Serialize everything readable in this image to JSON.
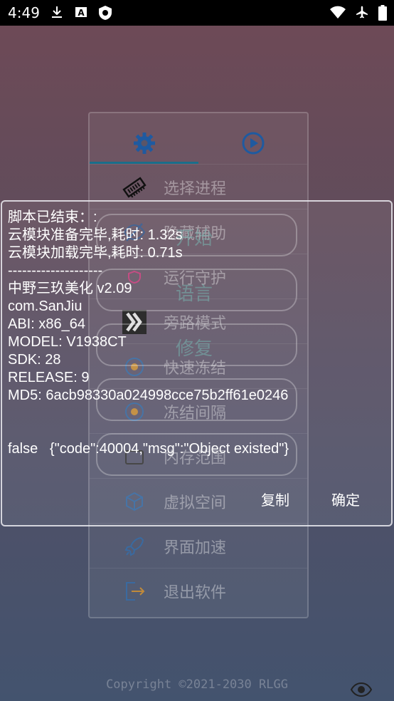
{
  "status_bar": {
    "time": "4:49",
    "left_icons": [
      "download-icon",
      "a-icon",
      "shield-icon"
    ],
    "right_icons": [
      "wifi-icon",
      "airplane-icon",
      "battery-icon"
    ]
  },
  "menu": {
    "tabs": [
      {
        "icon": "gear-icon",
        "selected": true
      },
      {
        "icon": "play-icon",
        "selected": false
      }
    ],
    "items": [
      {
        "icon": "memory-chip-icon",
        "label": "选择进程"
      },
      {
        "icon": "eye-off-icon",
        "label": "隐藏辅助"
      },
      {
        "icon": "shield-icon",
        "label": "运行守护"
      },
      {
        "icon": "double-chevron-icon",
        "label": "旁路模式"
      },
      {
        "icon": "snowflake-icon",
        "label": "快速冻结"
      },
      {
        "icon": "snowflake-icon",
        "label": "冻结间隔"
      },
      {
        "icon": "box-icon",
        "label": "内存范围"
      },
      {
        "icon": "cube-icon",
        "label": "虚拟空间"
      },
      {
        "icon": "rocket-icon",
        "label": "界面加速"
      },
      {
        "icon": "exit-icon",
        "label": "退出软件"
      }
    ],
    "overlay_buttons": [
      "开始",
      "语言",
      "修复"
    ]
  },
  "copyright": "Copyright ©2021-2030 RLGG",
  "dialog": {
    "lines": [
      "脚本已结束：:",
      "云模块准备完毕,耗时: 1.32s",
      "云模块加载完毕,耗时: 0.71s",
      "--------------------",
      "中野三玖美化 v2.09",
      "com.SanJiu",
      "ABI: x86_64",
      "MODEL: V1938CT",
      "SDK: 28",
      "RELEASE: 9",
      "MD5: 6acb98330a024998cce75b2ff61e0246",
      "",
      "",
      "false   {\"code\":40004,\"msg\":\"Object existed\"}"
    ],
    "copy_label": "复制",
    "ok_label": "确定"
  }
}
